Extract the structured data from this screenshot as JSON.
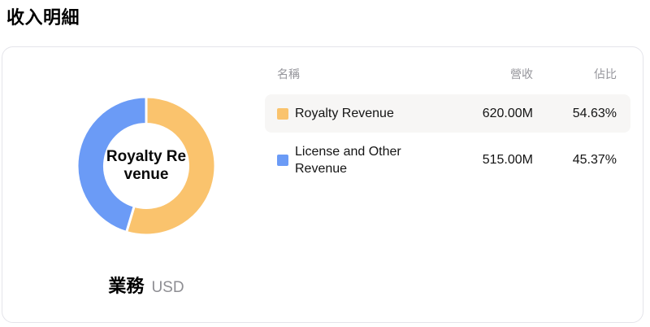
{
  "page": {
    "title": "收入明細"
  },
  "colors": {
    "orange": "#FAC36D",
    "blue": "#6B9BF6",
    "row_highlight": "#F7F6F5",
    "header_text": "#95959B",
    "card_border": "#E4E4EA"
  },
  "table": {
    "headers": {
      "name": "名稱",
      "revenue": "營收",
      "percent": "佔比"
    },
    "rows": [
      {
        "name": "Royalty Revenue",
        "revenue": "620.00M",
        "percent": "54.63%",
        "color": "#FAC36D",
        "highlighted": true
      },
      {
        "name": "License and Other Revenue",
        "revenue": "515.00M",
        "percent": "45.37%",
        "color": "#6B9BF6",
        "highlighted": false
      }
    ]
  },
  "chart_data": {
    "type": "pie",
    "subtype": "donut",
    "title": "業務",
    "unit": "USD",
    "center_label_lines": [
      "Royalty Re",
      "venue"
    ],
    "legend_position": "right-table",
    "segments": [
      {
        "label": "Royalty Revenue",
        "value": 620.0,
        "value_label": "620.00M",
        "percent": 54.63,
        "color": "#FAC36D"
      },
      {
        "label": "License and Other Revenue",
        "value": 515.0,
        "value_label": "515.00M",
        "percent": 45.37,
        "color": "#6B9BF6"
      }
    ]
  }
}
